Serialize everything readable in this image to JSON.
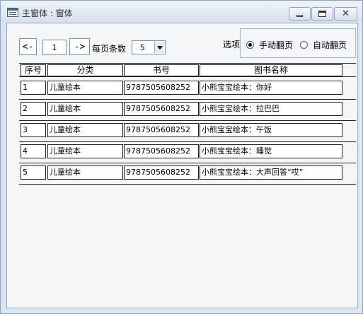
{
  "window": {
    "title": "主窗体 : 窗体"
  },
  "toolbar": {
    "prev_label": "<-",
    "page_value": "1",
    "next_label": "->",
    "per_page_label": "每页条数",
    "per_page_value": "5",
    "options_label": "选项",
    "radio_manual_label": "手动翻页",
    "radio_auto_label": "自动翻页",
    "selected_mode": "手动翻页"
  },
  "table": {
    "headers": [
      "序号",
      "分类",
      "书号",
      "图书名称"
    ],
    "rows": [
      {
        "index": "1",
        "category": "儿童绘本",
        "isbn": "9787505608252",
        "title": "小熊宝宝绘本：你好"
      },
      {
        "index": "2",
        "category": "儿童绘本",
        "isbn": "9787505608252",
        "title": "小熊宝宝绘本：拉巴巴"
      },
      {
        "index": "3",
        "category": "儿童绘本",
        "isbn": "9787505608252",
        "title": "小熊宝宝绘本：午饭"
      },
      {
        "index": "4",
        "category": "儿童绘本",
        "isbn": "9787505608252",
        "title": "小熊宝宝绘本：睡觉"
      },
      {
        "index": "5",
        "category": "儿童绘本",
        "isbn": "9787505608252",
        "title": "小熊宝宝绘本：大声回答“哎”"
      }
    ]
  }
}
